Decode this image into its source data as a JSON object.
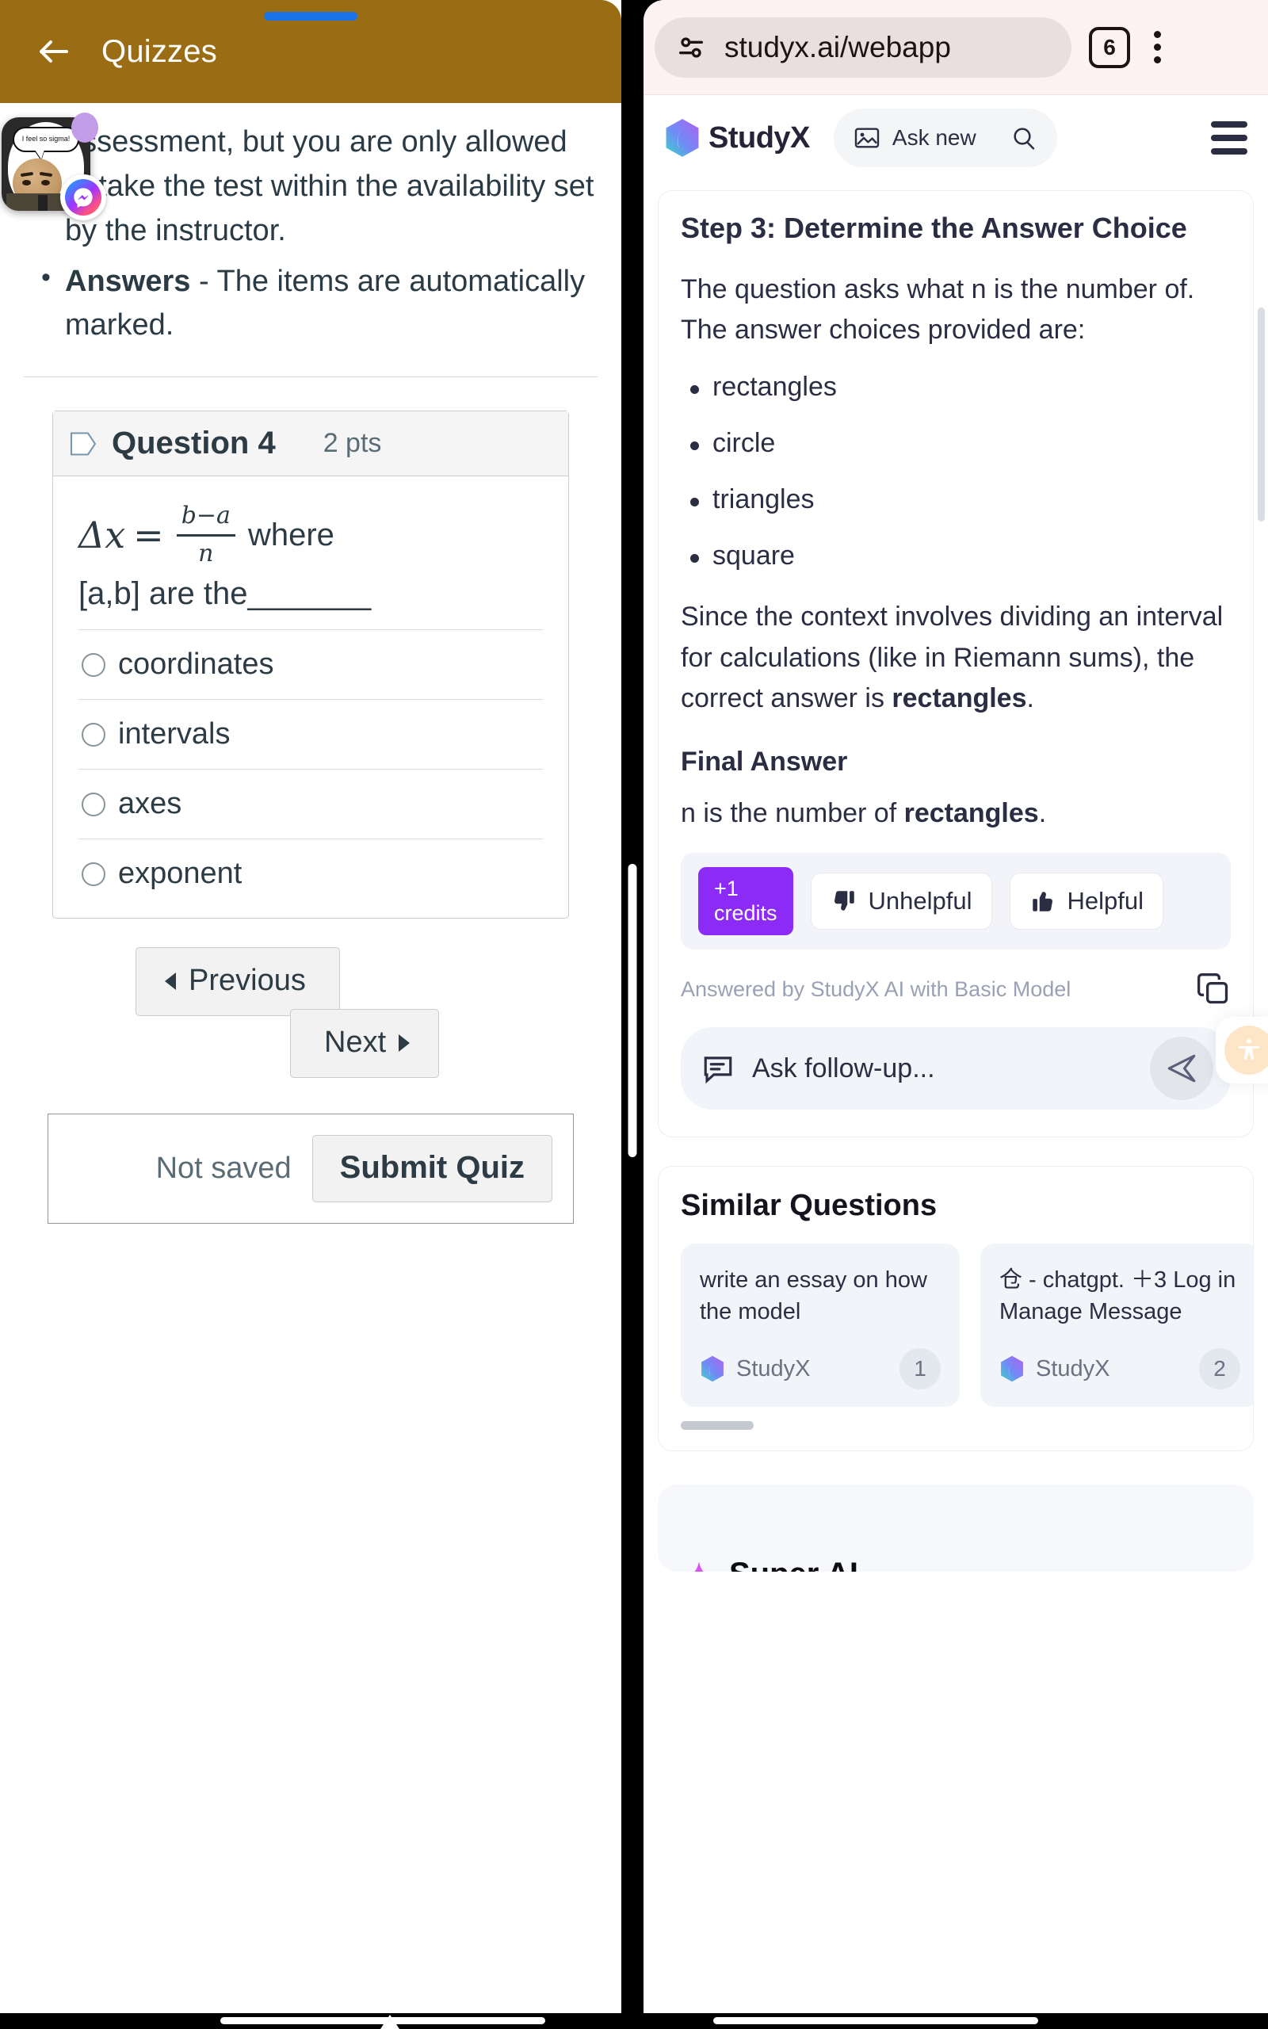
{
  "left_app": {
    "header": {
      "title": "Quizzes",
      "back_icon": "back-arrow-icon",
      "status_indicator": "blue-pill"
    },
    "content": {
      "paragraph_1": "assessment, but you are only allowed to take the test within the availability set by the instructor.",
      "bullet_1_label": "Answers",
      "bullet_1_rest": " - The items are automatically marked."
    },
    "question": {
      "flag_icon": "flag-icon",
      "title": "Question 4",
      "points": "2 pts",
      "formula_lhs": "Δx",
      "formula_eq": "=",
      "formula_numerator": "b−a",
      "formula_denominator": "n",
      "formula_where": "where",
      "prompt": "[a,b] are the_______",
      "options": [
        {
          "label": "coordinates",
          "selected": false
        },
        {
          "label": "intervals",
          "selected": false
        },
        {
          "label": "axes",
          "selected": false
        },
        {
          "label": "exponent",
          "selected": false
        }
      ]
    },
    "nav": {
      "previous_label": "Previous",
      "next_label": "Next"
    },
    "footer": {
      "save_status": "Not saved",
      "submit_label": "Submit Quiz"
    },
    "chat_head": {
      "bubble_text": "I feel so sigma!",
      "app_icon": "messenger-icon",
      "badge": "purple-dot-badge"
    }
  },
  "browser": {
    "url": "studyx.ai/webapp",
    "site_settings_icon": "tune-icon",
    "tab_count": "6",
    "menu_icon": "kebab-menu-icon"
  },
  "studyx": {
    "brand": "StudyX",
    "ask_new_label": "Ask new",
    "ask_new_image_icon": "image-icon",
    "ask_new_search_icon": "search-icon",
    "menu_icon": "hamburger-icon",
    "answer": {
      "step_title": "Step 3: Determine the Answer Choice",
      "intro": "The question asks what n is the number of. The answer choices provided are:",
      "choices": [
        "rectangles",
        "circle",
        "triangles",
        "square"
      ],
      "conclusion_prefix": "Since the context involves dividing an interval for calculations (like in Riemann sums), the correct answer is ",
      "conclusion_bold": "rectangles",
      "conclusion_suffix": ".",
      "final_heading": "Final Answer",
      "final_prefix": "n is the number of ",
      "final_bold": "rectangles",
      "final_suffix": ".",
      "credits_badge_line1": "+1",
      "credits_badge_line2": "credits",
      "unhelpful_label": "Unhelpful",
      "helpful_label": "Helpful",
      "unhelpful_icon": "thumb-down-icon",
      "helpful_icon": "thumb-up-icon",
      "answered_by": "Answered by StudyX AI with Basic Model",
      "copy_icon": "copy-icon",
      "followup_placeholder": "Ask follow-up...",
      "followup_icon": "chat-bubble-icon",
      "send_icon": "send-icon"
    },
    "similar": {
      "heading": "Similar Questions",
      "items": [
        {
          "question": "write an essay on how the model",
          "brand": "StudyX",
          "count": "1"
        },
        {
          "question": "仓 - chatgpt. ＋3 Log in Manage Message",
          "brand": "StudyX",
          "count": "2"
        }
      ]
    },
    "super_ai": {
      "label": "Super AI",
      "icon": "sparkle-icon"
    },
    "accessibility_fab": "accessibility-icon"
  },
  "colors": {
    "canvas_header": "#9a6d14",
    "chrome_bar": "#fdf2f2",
    "credits_purple": "#8b2bf5",
    "text_dark": "#2b2d42",
    "muted": "#9aa1b4"
  }
}
